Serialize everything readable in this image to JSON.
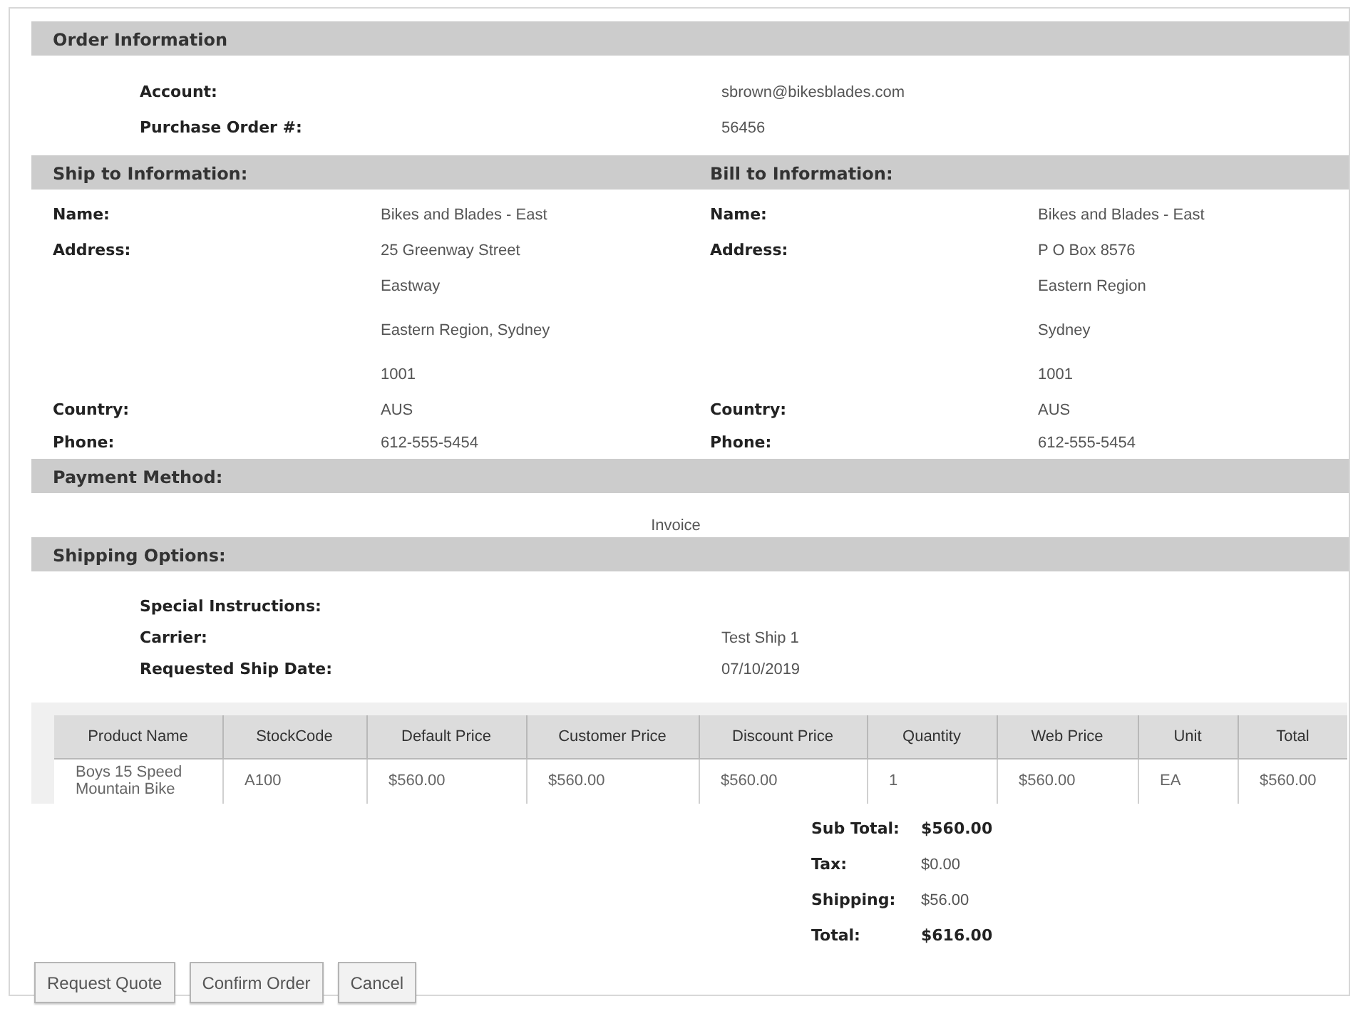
{
  "order_information": {
    "title": "Order Information",
    "fields": [
      {
        "label": "Account:",
        "value": "sbrown@bikesblades.com"
      },
      {
        "label": "Purchase Order #:",
        "value": "56456"
      }
    ]
  },
  "ship_to": {
    "title": "Ship to Information:",
    "name_label": "Name:",
    "name": "Bikes and Blades - East",
    "address_label": "Address:",
    "address_lines": [
      "25 Greenway Street",
      "Eastway",
      "Eastern Region, Sydney",
      "1001"
    ],
    "country_label": "Country:",
    "country": "AUS",
    "phone_label": "Phone:",
    "phone": "612-555-5454"
  },
  "bill_to": {
    "title": "Bill to Information:",
    "name_label": "Name:",
    "name": "Bikes and Blades - East",
    "address_label": "Address:",
    "address_lines": [
      "P O Box 8576",
      "Eastern Region",
      "Sydney",
      "1001"
    ],
    "country_label": "Country:",
    "country": "AUS",
    "phone_label": "Phone:",
    "phone": "612-555-5454"
  },
  "payment_method": {
    "title": "Payment Method:",
    "value": "Invoice"
  },
  "shipping_options": {
    "title": "Shipping Options:",
    "fields": [
      {
        "label": "Special Instructions:"
      },
      {
        "label": "Carrier:",
        "value": "Test Ship 1"
      },
      {
        "label": "Requested Ship Date:",
        "value": "07/10/2019"
      }
    ]
  },
  "table": {
    "columns": [
      "Product Name",
      "StockCode",
      "Default Price",
      "Customer Price",
      "Discount Price",
      "Quantity",
      "Web Price",
      "Unit",
      "Total"
    ],
    "rows": [
      [
        "Boys 15 Speed Mountain Bike",
        "A100",
        "$560.00",
        "$560.00",
        "$560.00",
        "1",
        "$560.00",
        "EA",
        "$560.00"
      ]
    ]
  },
  "totals": [
    {
      "label": "Sub Total:",
      "value": "$560.00",
      "bold": true
    },
    {
      "label": "Tax:",
      "value": "$0.00",
      "bold": false
    },
    {
      "label": "Shipping:",
      "value": "$56.00",
      "bold": false
    },
    {
      "label": "Total:",
      "value": "$616.00",
      "bold": true
    }
  ],
  "buttons": [
    "Request Quote",
    "Confirm Order",
    "Cancel"
  ]
}
